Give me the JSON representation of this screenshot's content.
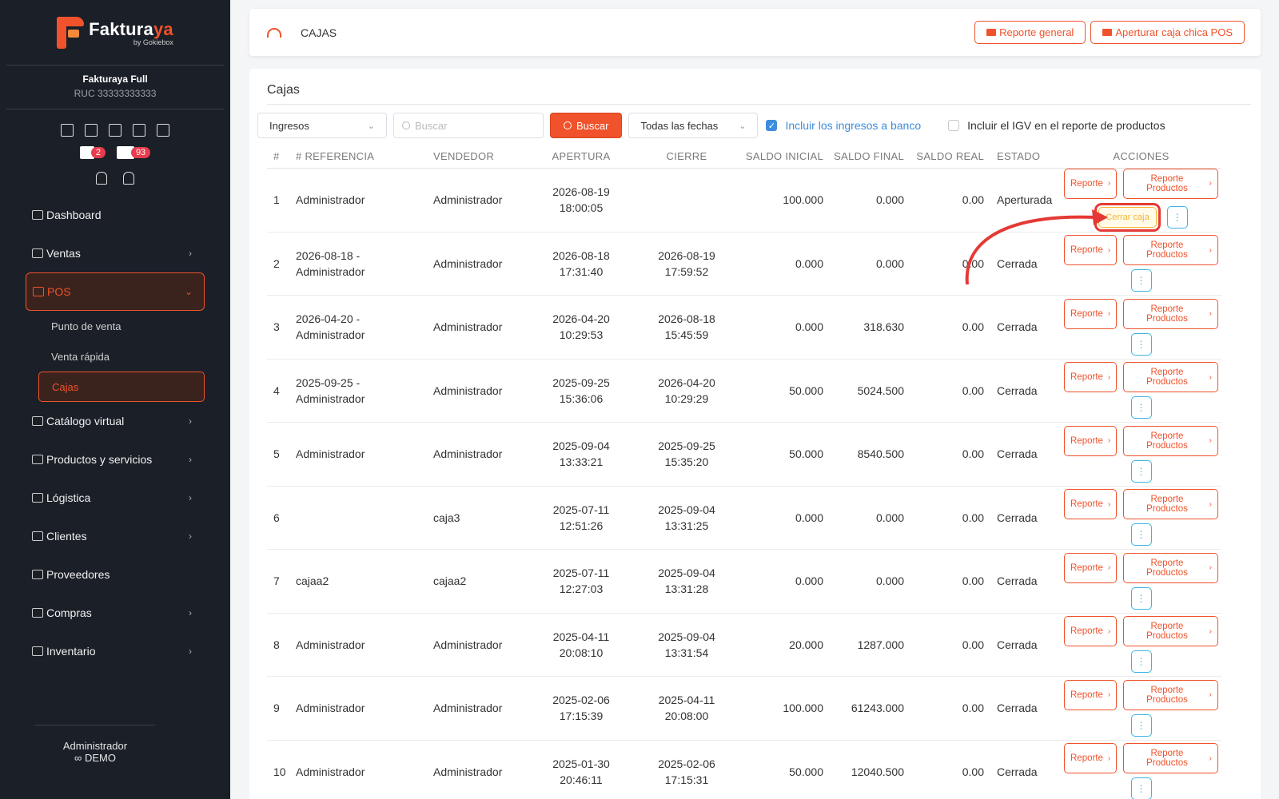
{
  "brand": {
    "name_main": "Faktura",
    "name_accent": "ya",
    "byline": "by Gokiebox"
  },
  "company": {
    "name": "Fakturaya Full",
    "ruc": "RUC 33333333333"
  },
  "badges": [
    {
      "icon": "calendar-x-icon",
      "count": "2"
    },
    {
      "icon": "boxes-icon",
      "count": "93"
    }
  ],
  "sidebar": {
    "items": [
      {
        "label": "Dashboard",
        "icon": "dashboard-icon",
        "chev": ""
      },
      {
        "label": "Ventas",
        "icon": "sales-icon",
        "chev": "›"
      },
      {
        "label": "POS",
        "icon": "monitor-icon",
        "chev": "⌄"
      },
      {
        "label": "Catálogo virtual",
        "icon": "store-icon",
        "chev": "›"
      },
      {
        "label": "Productos y servicios",
        "icon": "box-icon",
        "chev": "›"
      },
      {
        "label": "Lógistica",
        "icon": "tag-icon",
        "chev": "›"
      },
      {
        "label": "Clientes",
        "icon": "users-icon",
        "chev": "›"
      },
      {
        "label": "Proveedores",
        "icon": "briefcase-icon",
        "chev": ""
      },
      {
        "label": "Compras",
        "icon": "cart-bag-icon",
        "chev": "›"
      },
      {
        "label": "Inventario",
        "icon": "book-icon",
        "chev": "›"
      }
    ],
    "pos_sub": [
      "Punto de venta",
      "Venta rápida",
      "Cajas"
    ]
  },
  "user": {
    "name": "Administrador",
    "mode": "DEMO"
  },
  "header": {
    "breadcrumb": "CAJAS",
    "btn_general": "Reporte general",
    "btn_open": "Apertura​r caja chica POS"
  },
  "panel": {
    "title": "Cajas"
  },
  "filters": {
    "type": "Ingresos",
    "search_placeholder": "Buscar",
    "search_btn": "Buscar",
    "date": "Todas las fechas",
    "chk_bank": "Incluir los ingresos a banco",
    "chk_igv": "Incluir el IGV en el reporte de productos"
  },
  "table": {
    "headers": [
      "#",
      "# REFERENCIA",
      "VENDEDOR",
      "APERTURA",
      "CIERRE",
      "SALDO INICIAL",
      "SALDO FINAL",
      "SALDO REAL",
      "ESTADO",
      "ACCIONES"
    ],
    "btn_reporte": "Reporte",
    "btn_reporte_productos": "Reporte Productos",
    "btn_cerrar": "Cerrar caja",
    "rows": [
      {
        "n": "1",
        "ref1": "Administrador",
        "ref2": "",
        "ven": "Administrador",
        "ape1": "2026-08-19",
        "ape2": "18:00:05",
        "cie1": "",
        "cie2": "",
        "si": "100.000",
        "sf": "0.000",
        "sr": "0.00",
        "est": "Aperturada"
      },
      {
        "n": "2",
        "ref1": "2026-08-18 -",
        "ref2": "Administrador",
        "ven": "Administrador",
        "ape1": "2026-08-18",
        "ape2": "17:31:40",
        "cie1": "2026-08-19",
        "cie2": "17:59:52",
        "si": "0.000",
        "sf": "0.000",
        "sr": "0.00",
        "est": "Cerrada"
      },
      {
        "n": "3",
        "ref1": "2026-04-20 -",
        "ref2": "Administrador",
        "ven": "Administrador",
        "ape1": "2026-04-20",
        "ape2": "10:29:53",
        "cie1": "2026-08-18",
        "cie2": "15:45:59",
        "si": "0.000",
        "sf": "318.630",
        "sr": "0.00",
        "est": "Cerrada"
      },
      {
        "n": "4",
        "ref1": "2025-09-25 -",
        "ref2": "Administrador",
        "ven": "Administrador",
        "ape1": "2025-09-25",
        "ape2": "15:36:06",
        "cie1": "2026-04-20",
        "cie2": "10:29:29",
        "si": "50.000",
        "sf": "5024.500",
        "sr": "0.00",
        "est": "Cerrada"
      },
      {
        "n": "5",
        "ref1": "Administrador",
        "ref2": "",
        "ven": "Administrador",
        "ape1": "2025-09-04",
        "ape2": "13:33:21",
        "cie1": "2025-09-25",
        "cie2": "15:35:20",
        "si": "50.000",
        "sf": "8540.500",
        "sr": "0.00",
        "est": "Cerrada"
      },
      {
        "n": "6",
        "ref1": "",
        "ref2": "",
        "ven": "caja3",
        "ape1": "2025-07-11",
        "ape2": "12:51:26",
        "cie1": "2025-09-04",
        "cie2": "13:31:25",
        "si": "0.000",
        "sf": "0.000",
        "sr": "0.00",
        "est": "Cerrada"
      },
      {
        "n": "7",
        "ref1": "cajaa2",
        "ref2": "",
        "ven": "cajaa2",
        "ape1": "2025-07-11",
        "ape2": "12:27:03",
        "cie1": "2025-09-04",
        "cie2": "13:31:28",
        "si": "0.000",
        "sf": "0.000",
        "sr": "0.00",
        "est": "Cerrada"
      },
      {
        "n": "8",
        "ref1": "Administrador",
        "ref2": "",
        "ven": "Administrador",
        "ape1": "2025-04-11",
        "ape2": "20:08:10",
        "cie1": "2025-09-04",
        "cie2": "13:31:54",
        "si": "20.000",
        "sf": "1287.000",
        "sr": "0.00",
        "est": "Cerrada"
      },
      {
        "n": "9",
        "ref1": "Administrador",
        "ref2": "",
        "ven": "Administrador",
        "ape1": "2025-02-06",
        "ape2": "17:15:39",
        "cie1": "2025-04-11",
        "cie2": "20:08:00",
        "si": "100.000",
        "sf": "61243.000",
        "sr": "0.00",
        "est": "Cerrada"
      },
      {
        "n": "10",
        "ref1": "Administrador",
        "ref2": "",
        "ven": "Administrador",
        "ape1": "2025-01-30",
        "ape2": "20:46:11",
        "cie1": "2025-02-06",
        "cie2": "17:15:31",
        "si": "50.000",
        "sf": "12040.500",
        "sr": "0.00",
        "est": "Cerrada"
      }
    ]
  },
  "colors": {
    "accent": "#f0522b",
    "sidebar_bg": "#1b2028",
    "info": "#3cb6e0",
    "warning": "#f5b531",
    "annotation": "#e53935"
  }
}
